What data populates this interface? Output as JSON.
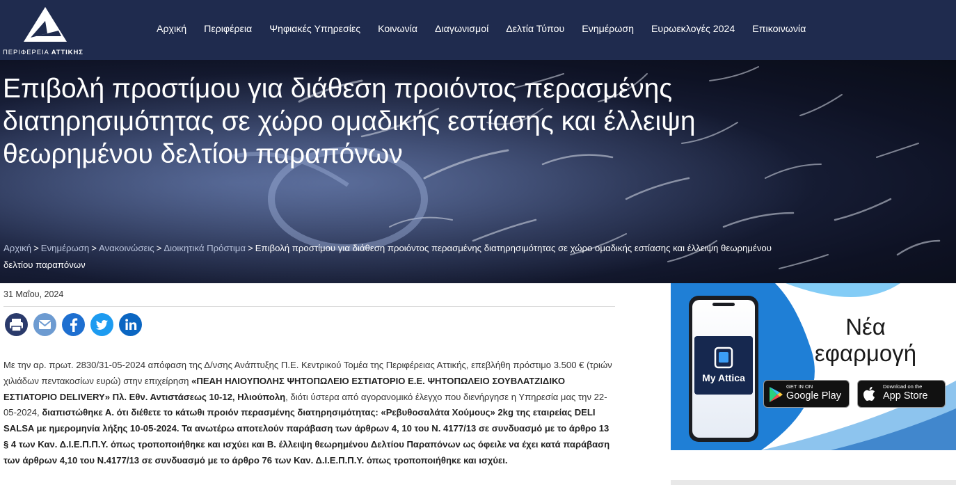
{
  "header": {
    "logo_text_light": "ΠΕΡΙΦΕΡΕΙΑ",
    "logo_text_bold": "ΑΤΤΙΚΗΣ",
    "nav": [
      {
        "label": "Αρχική"
      },
      {
        "label": "Περιφέρεια"
      },
      {
        "label": "Ψηφιακές Υπηρεσίες"
      },
      {
        "label": "Κοινωνία"
      },
      {
        "label": "Διαγωνισμοί"
      },
      {
        "label": "Δελτία Τύπου"
      },
      {
        "label": "Ενημέρωση"
      },
      {
        "label": "Ευρωεκλογές 2024"
      },
      {
        "label": "Επικοινωνία"
      }
    ]
  },
  "hero": {
    "title": "Επιβολή προστίμου για διάθεση προιόντος περασμένης διατηρησιμότητας σε χώρο ομαδικής εστίασης και έλλειψη θεωρημένου δελτίου παραπόνων"
  },
  "breadcrumb": {
    "items": [
      "Αρχική",
      "Ενημέρωση",
      "Ανακοινώσεις",
      "Διοικητικά Πρόστιμα"
    ],
    "separator": ">",
    "current": "Επιβολή προστίμου για διάθεση προιόντος περασμένης διατηρησιμότητας σε χώρο ομαδικής εστίασης και έλλειψη θεωρημένου δελτίου παραπόνων"
  },
  "article": {
    "date": "31 Μαΐου, 2024",
    "share_icons": [
      "print-icon",
      "email-icon",
      "facebook-icon",
      "twitter-icon",
      "linkedin-icon"
    ],
    "p1": "Με την αρ. πρωτ. 2830/31-05-2024 απόφαση της Δ/νσης Ανάπτυξης Π.Ε. Κεντρικού Τομέα της Περιφέρειας Αττικής, επεβλήθη πρόστιμο 3.500 € (τριών χιλιάδων πεντακοσίων ευρώ) στην επιχείρηση ",
    "b1": "«ΠΕΑΗ ΗΛΙΟΥΠΟΛΗΣ ΨΗΤΟΠΩΛΕΙΟ ΕΣΤΙΑΤΟΡΙΟ Ε.Ε. ΨΗΤΟΠΩΛΕΙΟ ΣΟΥΒΛΑΤΖΙΔΙΚΟ ΕΣΤΙΑΤΟΡΙΟ DELIVERY» Πλ. Εθν. Αντιστάσεως 10-12, Ηλιούπολη",
    "p2": ", διότι ύστερα από αγορανομικό έλεγχο που διενήργησε η Υπηρεσία μας την 22-05-2024, ",
    "b2": "διαπιστώθηκε Α. ότι διέθετε το κάτωθι προιόν περασμένης διατηρησιμότητας: «Ρεβυθοσαλάτα Χούμους» 2kg της εταιρείας DELI SALSA με ημερομηνία λήξης 10-05-2024. Τα ανωτέρω αποτελούν παράβαση των άρθρων 4, 10 του Ν. 4177/13 σε συνδυασμό με το άρθρο 13 § 4 των Καν. Δ.Ι.Ε.Π.Π.Υ. όπως τροποποιήθηκε και ισχύει και Β. έλλειψη θεωρημένου Δελτίου Παραπόνων ως όφειλε να έχει κατά παράβαση των άρθρων 4,10 του Ν.4177/13 σε συνδυασμό με το άρθρο 76 των Καν. Δ.Ι.Ε.Π.Π.Υ. όπως τροποποιήθηκε και ισχύει."
  },
  "ad": {
    "headline_1": "Νέα",
    "headline_2": "εφαρμογή",
    "app_name": "My Attica",
    "google_small": "GET IN ON",
    "google_big": "Google Play",
    "apple_small": "Download on the",
    "apple_big": "App Store"
  },
  "colors": {
    "header_bg": "#1f2b4e",
    "ad_blue": "#1f8ad9"
  }
}
